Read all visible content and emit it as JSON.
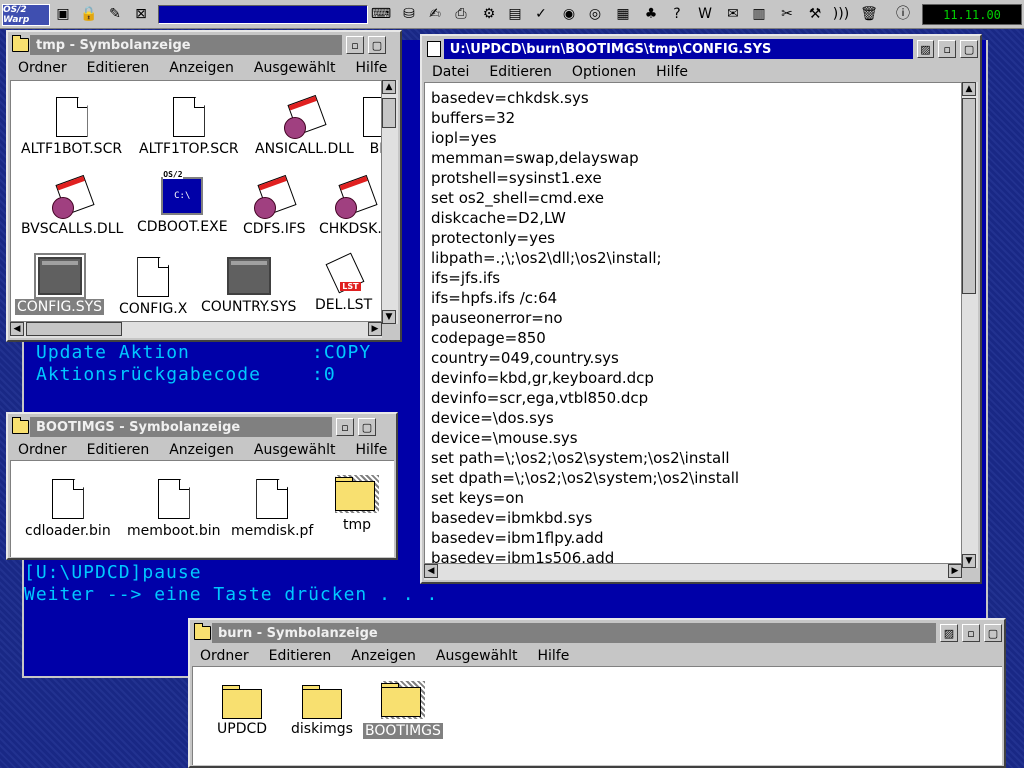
{
  "taskbar": {
    "logo": "OS/2 Warp",
    "clock": "11.11.00"
  },
  "console": {
    "update_action_label": "Update Aktion",
    "update_action_value": ":COPY",
    "return_code_label": "Aktionsrückgabecode",
    "return_code_value": ":0",
    "pause_line": "[U:\\UPDCD]pause",
    "continue_line": "Weiter --> eine Taste drücken . . ."
  },
  "tmp_window": {
    "title": "tmp - Symbolanzeige",
    "menu": [
      "Ordner",
      "Editieren",
      "Anzeigen",
      "Ausgewählt",
      "Hilfe"
    ],
    "icons": [
      {
        "label": "ALTF1BOT.SCR",
        "type": "document"
      },
      {
        "label": "ALTF1TOP.SCR",
        "type": "document"
      },
      {
        "label": "ANSICALL.DLL",
        "type": "dll"
      },
      {
        "label": "BK",
        "type": "document"
      },
      {
        "label": "BVSCALLS.DLL",
        "type": "dll"
      },
      {
        "label": "CDBOOT.EXE",
        "type": "exe"
      },
      {
        "label": "CDFS.IFS",
        "type": "dll"
      },
      {
        "label": "CHKDSK.S",
        "type": "dll"
      },
      {
        "label": "CONFIG.SYS",
        "type": "sysfile",
        "selected": true
      },
      {
        "label": "CONFIG.X",
        "type": "document"
      },
      {
        "label": "COUNTRY.SYS",
        "type": "sysfile"
      },
      {
        "label": "DEL.LST",
        "type": "lst"
      }
    ]
  },
  "bootimgs_window": {
    "title": "BOOTIMGS - Symbolanzeige",
    "menu": [
      "Ordner",
      "Editieren",
      "Anzeigen",
      "Ausgewählt",
      "Hilfe"
    ],
    "icons": [
      {
        "label": "cdloader.bin",
        "type": "document"
      },
      {
        "label": "memboot.bin",
        "type": "document"
      },
      {
        "label": "memdisk.pf",
        "type": "document"
      },
      {
        "label": "tmp",
        "type": "folder"
      }
    ]
  },
  "editor_window": {
    "title": "U:\\UPDCD\\burn\\BOOTIMGS\\tmp\\CONFIG.SYS",
    "menu": [
      "Datei",
      "Editieren",
      "Optionen",
      "Hilfe"
    ],
    "lines": [
      "basedev=chkdsk.sys",
      "buffers=32",
      "iopl=yes",
      "memman=swap,delayswap",
      "protshell=sysinst1.exe",
      "set os2_shell=cmd.exe",
      "diskcache=D2,LW",
      "protectonly=yes",
      "libpath=.;\\;\\os2\\dll;\\os2\\install;",
      "ifs=jfs.ifs",
      "ifs=hpfs.ifs /c:64",
      "pauseonerror=no",
      "codepage=850",
      "country=049,country.sys",
      "devinfo=kbd,gr,keyboard.dcp",
      "devinfo=scr,ega,vtbl850.dcp",
      "device=\\dos.sys",
      "device=\\mouse.sys",
      "set path=\\;\\os2;\\os2\\system;\\os2\\install",
      "set dpath=\\;\\os2;\\os2\\system;\\os2\\install",
      "set keys=on",
      "basedev=ibmkbd.sys",
      "basedev=ibm1flpy.add",
      "basedev=ibm1s506.add"
    ]
  },
  "burn_window": {
    "title": "burn - Symbolanzeige",
    "menu": [
      "Ordner",
      "Editieren",
      "Anzeigen",
      "Ausgewählt",
      "Hilfe"
    ],
    "icons": [
      {
        "label": "UPDCD",
        "type": "folder"
      },
      {
        "label": "diskimgs",
        "type": "folder"
      },
      {
        "label": "BOOTIMGS",
        "type": "folder",
        "selected": true
      }
    ]
  },
  "colors": {
    "desktop": "#1a2a8c",
    "console_bg": "#0000a8",
    "console_text": "#00c8ff",
    "active_title": "#0000a8",
    "inactive_title": "#808080",
    "clock_text": "#00d000"
  }
}
